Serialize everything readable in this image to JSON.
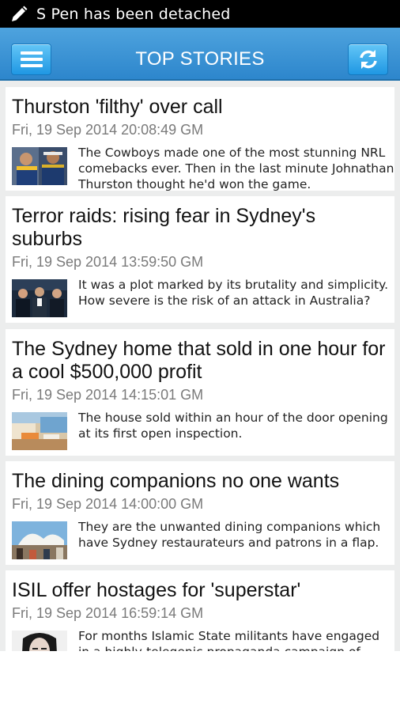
{
  "status_bar": {
    "message": "S Pen has been detached",
    "icon": "pen-icon"
  },
  "app_bar": {
    "title": "TOP STORIES",
    "menu_icon": "menu-icon",
    "refresh_icon": "refresh-icon"
  },
  "stories": [
    {
      "headline": "Thurston 'filthy' over call",
      "date": "Fri, 19 Sep 2014 20:08:49 GM",
      "summary": "The Cowboys made one of the most stunning NRL comebacks ever. Then in the last minute Johnathan Thurston thought he'd won the game."
    },
    {
      "headline": "Terror raids: rising fear in Sydney's suburbs",
      "date": "Fri, 19 Sep 2014 13:59:50 GM",
      "summary": "It was a plot marked by its brutality and simplicity. How severe is the risk of an attack in Australia?"
    },
    {
      "headline": "The Sydney home that sold in one hour for a cool $500,000 profit",
      "date": "Fri, 19 Sep 2014 14:15:01 GM",
      "summary": "The house sold within an hour of the door opening at its first open inspection."
    },
    {
      "headline": "The dining companions no one wants",
      "date": "Fri, 19 Sep 2014 14:00:00 GM",
      "summary": "They are the unwanted dining companions which have Sydney restaurateurs and patrons in a flap."
    },
    {
      "headline": "ISIL offer hostages for 'superstar'",
      "date": "Fri, 19 Sep 2014 16:59:14 GM",
      "summary": "For months Islamic State militants have engaged in a highly-telegenic propaganda campaign of horror."
    }
  ]
}
